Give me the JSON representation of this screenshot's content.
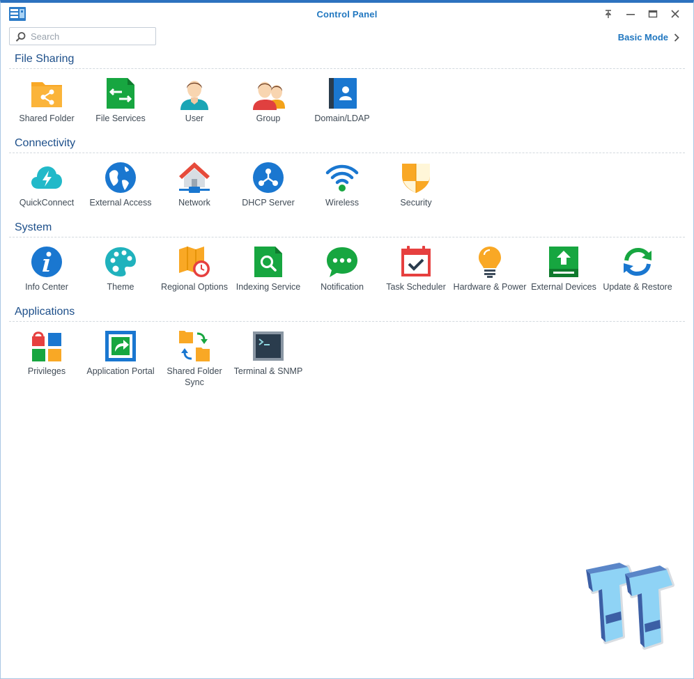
{
  "window": {
    "title": "Control Panel",
    "icon": "control-panel-icon"
  },
  "window_controls": [
    {
      "name": "help-button",
      "icon": "pin-icon"
    },
    {
      "name": "minimize-button",
      "icon": "minimize-icon"
    },
    {
      "name": "maximize-button",
      "icon": "maximize-icon"
    },
    {
      "name": "close-button",
      "icon": "close-icon"
    }
  ],
  "search": {
    "placeholder": "Search",
    "value": ""
  },
  "mode_link": {
    "label": "Basic Mode"
  },
  "sections": [
    {
      "title": "File Sharing",
      "items": [
        {
          "label": "Shared Folder",
          "icon": "shared-folder-icon"
        },
        {
          "label": "File Services",
          "icon": "file-services-icon"
        },
        {
          "label": "User",
          "icon": "user-icon"
        },
        {
          "label": "Group",
          "icon": "group-icon"
        },
        {
          "label": "Domain/LDAP",
          "icon": "domain-ldap-icon"
        }
      ]
    },
    {
      "title": "Connectivity",
      "items": [
        {
          "label": "QuickConnect",
          "icon": "quickconnect-icon"
        },
        {
          "label": "External Access",
          "icon": "external-access-icon"
        },
        {
          "label": "Network",
          "icon": "network-icon"
        },
        {
          "label": "DHCP Server",
          "icon": "dhcp-server-icon"
        },
        {
          "label": "Wireless",
          "icon": "wireless-icon"
        },
        {
          "label": "Security",
          "icon": "security-icon"
        }
      ]
    },
    {
      "title": "System",
      "items": [
        {
          "label": "Info Center",
          "icon": "info-center-icon"
        },
        {
          "label": "Theme",
          "icon": "theme-icon"
        },
        {
          "label": "Regional Options",
          "icon": "regional-options-icon"
        },
        {
          "label": "Indexing Service",
          "icon": "indexing-service-icon"
        },
        {
          "label": "Notification",
          "icon": "notification-icon"
        },
        {
          "label": "Task Scheduler",
          "icon": "task-scheduler-icon"
        },
        {
          "label": "Hardware & Power",
          "icon": "hardware-power-icon"
        },
        {
          "label": "External Devices",
          "icon": "external-devices-icon"
        },
        {
          "label": "Update & Restore",
          "icon": "update-restore-icon"
        }
      ]
    },
    {
      "title": "Applications",
      "items": [
        {
          "label": "Privileges",
          "icon": "privileges-icon"
        },
        {
          "label": "Application Portal",
          "icon": "application-portal-icon"
        },
        {
          "label": "Shared Folder Sync",
          "icon": "shared-folder-sync-icon"
        },
        {
          "label": "Terminal & SNMP",
          "icon": "terminal-snmp-icon"
        }
      ]
    }
  ],
  "watermark": {
    "icon": "tt-logo-icon"
  },
  "colors": {
    "accent": "#2077c0",
    "titlebar_border": "#2d72bf",
    "section_title": "#1d4f8a",
    "label": "#3f4a55"
  }
}
